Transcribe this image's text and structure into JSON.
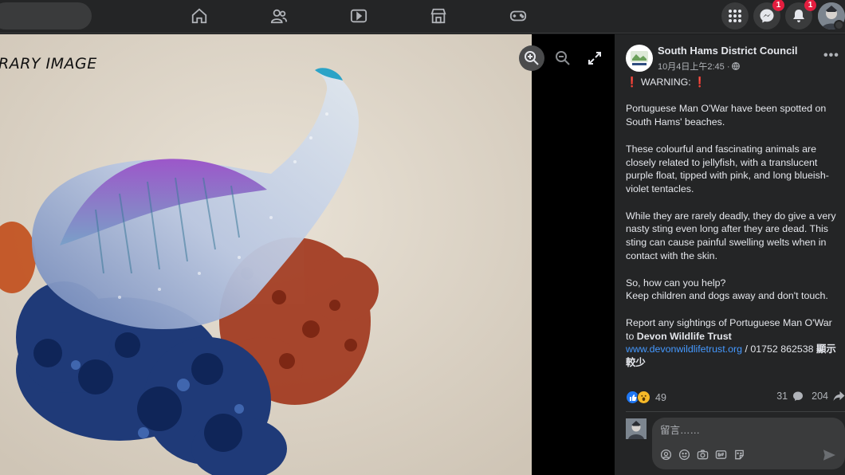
{
  "topbar": {
    "nav": [
      "home-icon",
      "friends-icon",
      "watch-icon",
      "marketplace-icon",
      "gaming-icon"
    ],
    "messenger_badge": "1",
    "notifications_badge": "1"
  },
  "photo": {
    "label": "RARY IMAGE"
  },
  "post": {
    "page_name": "South Hams District Council",
    "time": "10月4日上午2:45 ·",
    "warning": "❗ WARNING: ❗",
    "p1": "Portuguese Man O'War have been spotted on South Hams' beaches.",
    "p2": "These colourful and fascinating animals are closely related to jellyfish, with a translucent purple float, tipped with pink, and long blueish-violet tentacles.",
    "p3": "While they are rarely deadly, they do give a very nasty sting even long after they are dead. This sting can cause painful swelling welts when in contact with the skin.",
    "p4a": "So, how can you help?",
    "p4b": "Keep children and dogs away and don't touch.",
    "p5a": "Report any sightings of Portuguese Man O'War to ",
    "p5b": "Devon Wildlife Trust",
    "p5link": "www.devonwildlifetrust.org",
    "p5c": " / 01752 862538 ",
    "see_less": "顯示較少"
  },
  "reactions": {
    "count": "49",
    "comments": "31",
    "shares": "204"
  },
  "comment": {
    "placeholder": "留言……"
  },
  "colors": {
    "accent": "#4599ff",
    "badge": "#e41e3f",
    "like": "#2078f4"
  }
}
